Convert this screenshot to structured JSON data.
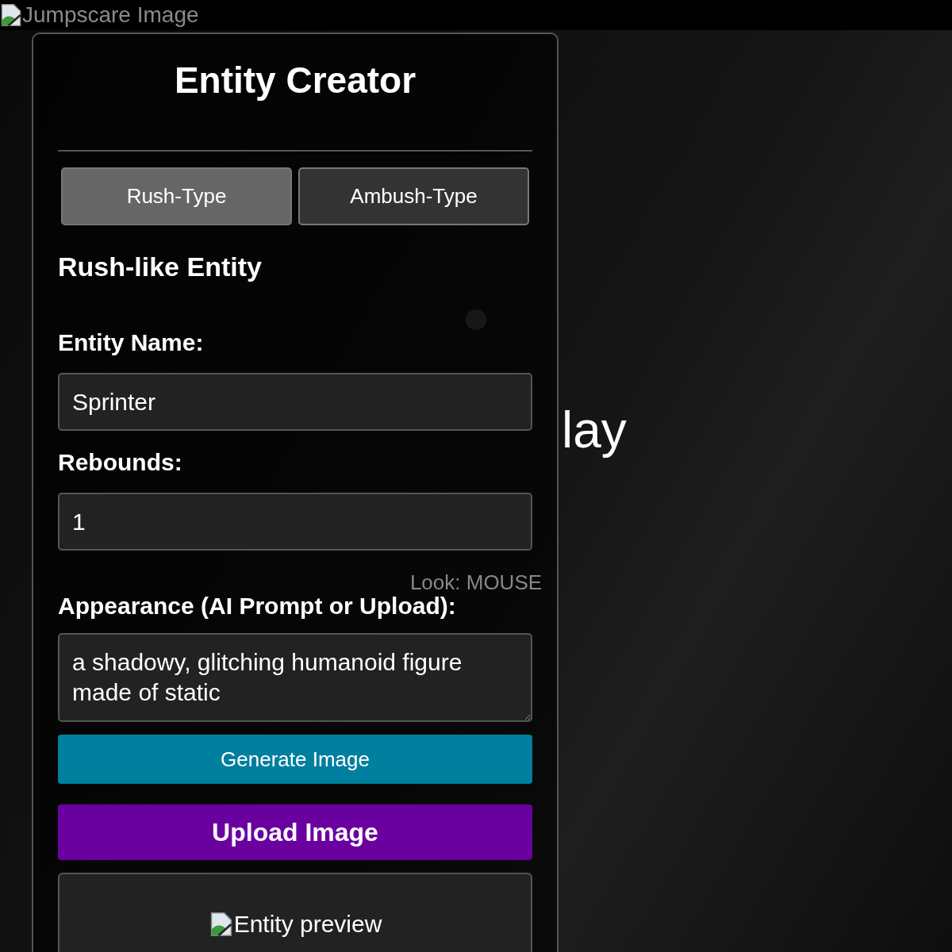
{
  "top_bar": {
    "broken_image_alt": "Jumpscare Image"
  },
  "scene": {
    "prompt": "lay",
    "controls": [
      "Look: MOUSE"
    ]
  },
  "panel": {
    "title": "Entity Creator",
    "tabs": [
      {
        "label": "Rush-Type",
        "selected": true
      },
      {
        "label": "Ambush-Type",
        "selected": false
      }
    ],
    "section_title": "Rush-like Entity",
    "fields": [
      {
        "kind": "input",
        "label": "Entity Name:",
        "value": "Sprinter"
      },
      {
        "kind": "input",
        "label": "Rebounds:",
        "value": "1"
      },
      {
        "kind": "textarea",
        "label": "Appearance (AI Prompt or Upload):",
        "value": "a shadowy, glitching humanoid figure made of static"
      }
    ],
    "buttons": [
      {
        "kind": "generate",
        "label": "Generate Image"
      },
      {
        "kind": "upload",
        "label": "Upload Image"
      }
    ],
    "preview": {
      "alt": "Entity preview"
    }
  }
}
